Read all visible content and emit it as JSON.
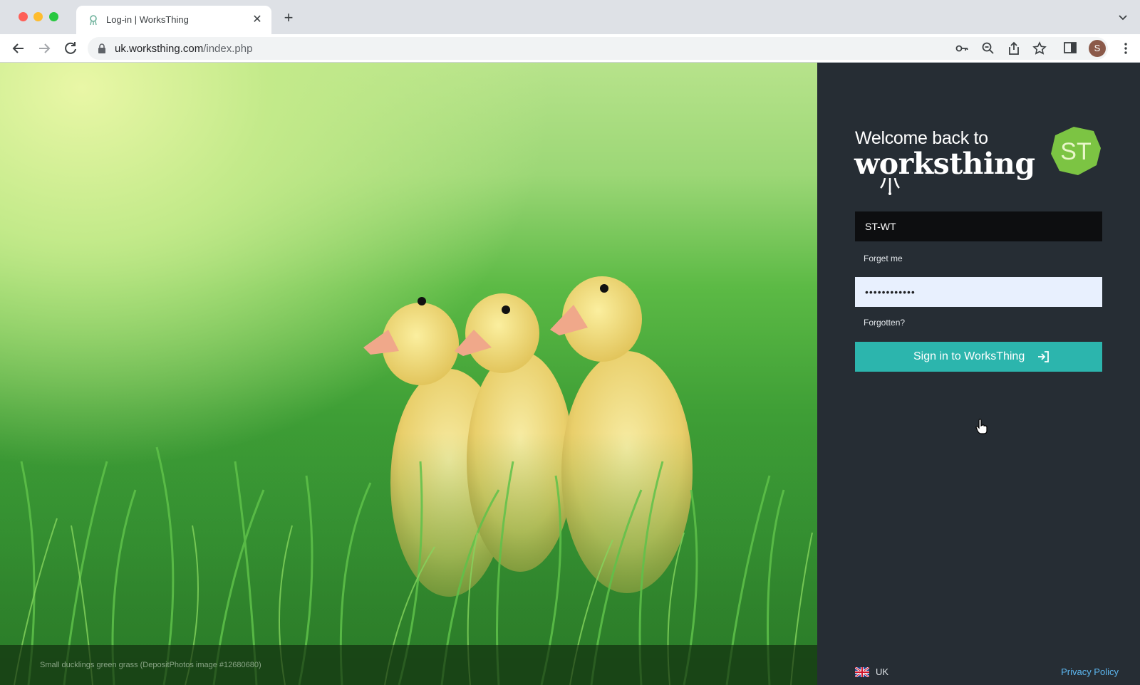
{
  "browser": {
    "tab_title": "Log-in | WorksThing",
    "new_tab_label": "+",
    "url_host": "uk.worksthing.com",
    "url_path": "/index.php",
    "profile_initial": "S"
  },
  "hero": {
    "caption": "Small ducklings green grass (DepositPhotos image #12680680)"
  },
  "login": {
    "welcome": "Welcome back to",
    "brand": "worksthing",
    "logo_text": "ST",
    "username_value": "ST-WT",
    "forget_me": "Forget me",
    "password_value": "••••••••••••",
    "forgotten": "Forgotten?",
    "signin_label": "Sign in to WorksThing"
  },
  "footer": {
    "locale": "UK",
    "privacy": "Privacy Policy"
  },
  "colors": {
    "panel_bg": "#262d34",
    "accent": "#2cb5ad",
    "logo_green": "#7cc443"
  },
  "icons": [
    "tab-favicon",
    "close-icon",
    "back-arrow-icon",
    "forward-arrow-icon",
    "reload-icon",
    "lock-icon",
    "key-icon",
    "zoom-icon",
    "share-icon",
    "star-icon",
    "side-panel-icon",
    "kebab-menu-icon",
    "sign-in-icon",
    "uk-flag-icon",
    "cursor-hand-icon"
  ]
}
